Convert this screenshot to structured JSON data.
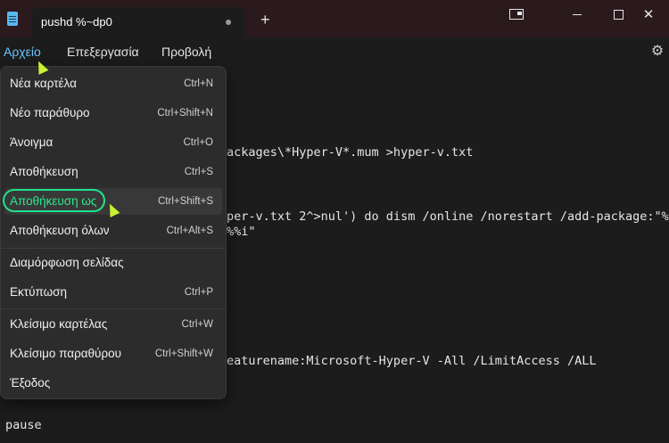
{
  "window": {
    "tab_title": "pushd %~dp0",
    "new_tab_glyph": "+",
    "controls": [
      "compact-overlay",
      "minimize",
      "maximize",
      "close"
    ]
  },
  "menubar": {
    "items": [
      {
        "label": "Αρχείο",
        "active": true
      },
      {
        "label": "Επεξεργασία",
        "active": false
      },
      {
        "label": "Προβολή",
        "active": false
      }
    ],
    "settings_icon": "gear-icon"
  },
  "file_menu": {
    "items": [
      {
        "label": "Νέα καρτέλα",
        "shortcut": "Ctrl+N"
      },
      {
        "label": "Νέο παράθυρο",
        "shortcut": "Ctrl+Shift+N"
      },
      {
        "label": "Άνοιγμα",
        "shortcut": "Ctrl+O"
      },
      {
        "label": "Αποθήκευση",
        "shortcut": "Ctrl+S"
      },
      {
        "label": "Αποθήκευση ως",
        "shortcut": "Ctrl+Shift+S",
        "highlighted": true
      },
      {
        "label": "Αποθήκευση όλων",
        "shortcut": "Ctrl+Alt+S"
      },
      {
        "label": "Διαμόρφωση σελίδας",
        "shortcut": ""
      },
      {
        "label": "Εκτύπωση",
        "shortcut": "Ctrl+P"
      },
      {
        "label": "Κλείσιμο καρτέλας",
        "shortcut": "Ctrl+W"
      },
      {
        "label": "Κλείσιμο παραθύρου",
        "shortcut": "Ctrl+Shift+W"
      },
      {
        "label": "Έξοδος",
        "shortcut": ""
      }
    ]
  },
  "editor": {
    "lines": [
      "ackages\\*Hyper-V*.mum >hyper-v.txt",
      "per-v.txt 2^>nul') do dism /online /norestart /add-package:\"%",
      "%%i\"",
      "eaturename:Microsoft-Hyper-V -All /LimitAccess /ALL",
      "pause"
    ]
  },
  "colors": {
    "accent": "#6cc8ff",
    "highlight_ring": "#1ee38a",
    "cursor": "#c9f230",
    "titlebar": "#2a1a1d"
  }
}
